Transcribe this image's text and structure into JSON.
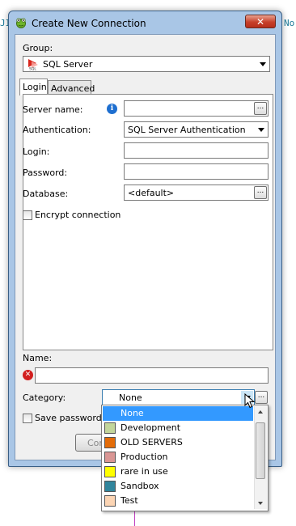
{
  "background": {
    "left_text": "JI",
    "right_text": "No"
  },
  "window": {
    "title": "Create New Connection",
    "close_label": "✕"
  },
  "group": {
    "label": "Group:",
    "value": "SQL Server"
  },
  "tabs": [
    {
      "label": "Login"
    },
    {
      "label": "Advanced"
    }
  ],
  "login": {
    "server_name_label": "Server name:",
    "server_name_value": "",
    "authentication_label": "Authentication:",
    "authentication_value": "SQL Server Authentication",
    "login_label": "Login:",
    "login_value": "",
    "password_label": "Password:",
    "password_value": "",
    "database_label": "Database:",
    "database_value": "<default>",
    "encrypt_label": "Encrypt connection"
  },
  "name": {
    "label": "Name:",
    "value": ""
  },
  "category": {
    "label": "Category:",
    "value": "None",
    "options": [
      {
        "label": "None",
        "color": "#3399ff"
      },
      {
        "label": "Development",
        "color": "#c3d69b"
      },
      {
        "label": "OLD SERVERS",
        "color": "#e36c09"
      },
      {
        "label": "Production",
        "color": "#d99694"
      },
      {
        "label": "rare in use",
        "color": "#ffff00"
      },
      {
        "label": "Sandbox",
        "color": "#31859c"
      },
      {
        "label": "Test",
        "color": "#fcd5b4"
      }
    ]
  },
  "save_password": {
    "label": "Save password"
  },
  "connect_button": {
    "label": "Connect"
  },
  "ellipsis": "..."
}
